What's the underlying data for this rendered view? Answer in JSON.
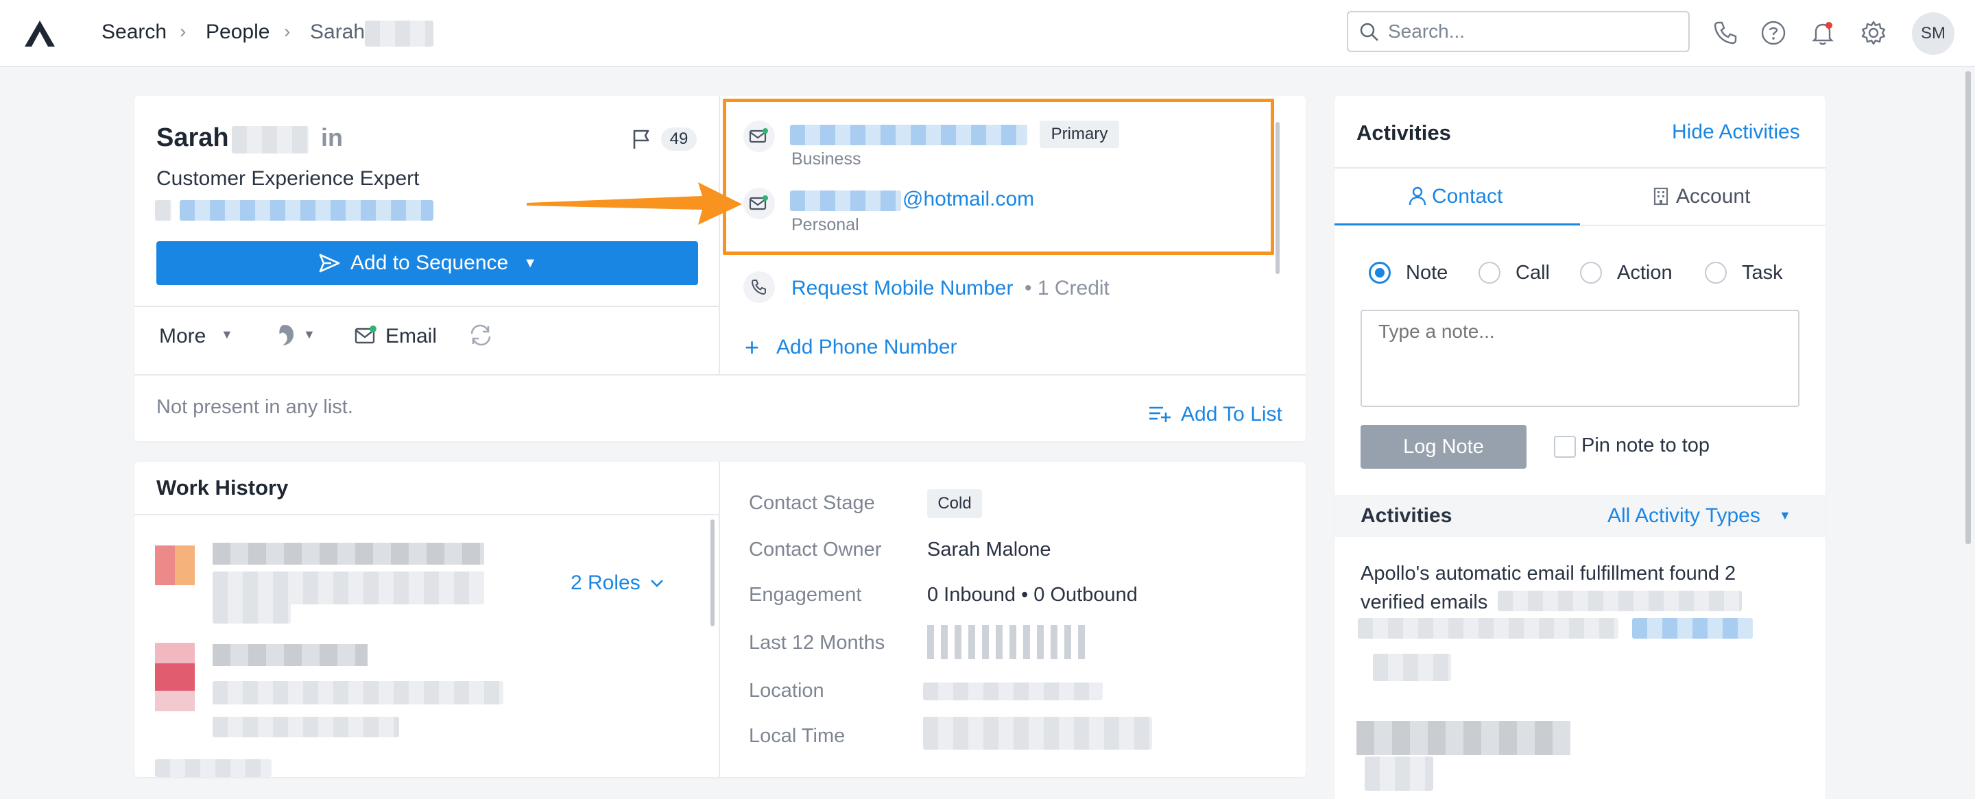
{
  "breadcrumb": {
    "search": "Search",
    "people": "People",
    "person": "Sarah"
  },
  "search": {
    "placeholder": "Search..."
  },
  "user": {
    "initials": "SM"
  },
  "profile": {
    "first_name": "Sarah",
    "linkedin": "in",
    "title": "Customer Experience Expert",
    "flag_count": "49",
    "add_to_sequence": "Add to Sequence",
    "more": "More",
    "email": "Email",
    "lists_status": "Not present in any list.",
    "add_to_list": "Add To List"
  },
  "contact_info": {
    "emails": [
      {
        "domain_suffix": "",
        "badge": "Primary",
        "type": "Business"
      },
      {
        "domain_suffix": "@hotmail.com",
        "type": "Personal"
      }
    ],
    "request_mobile": "Request Mobile Number",
    "credit": "• 1 Credit",
    "add_phone": "Add Phone Number"
  },
  "work_history": {
    "title": "Work History",
    "roles": "2 Roles"
  },
  "details": {
    "rows": [
      {
        "label": "Contact Stage",
        "value": "Cold"
      },
      {
        "label": "Contact Owner",
        "value": "Sarah Malone"
      },
      {
        "label": "Engagement",
        "value": "0 Inbound • 0 Outbound"
      },
      {
        "label": "Last 12 Months",
        "value": ""
      },
      {
        "label": "Location",
        "value": ""
      },
      {
        "label": "Local Time",
        "value": ""
      }
    ]
  },
  "activities": {
    "title": "Activities",
    "hide": "Hide Activities",
    "tabs": [
      "Contact",
      "Account"
    ],
    "types": [
      "Note",
      "Call",
      "Action",
      "Task"
    ],
    "note_placeholder": "Type a note...",
    "log_note": "Log Note",
    "pin_note": "Pin note to top",
    "feed_title": "Activities",
    "filter": "All Activity Types",
    "feed_text": "Apollo's automatic email fulfillment found 2 verified emails"
  },
  "colors": {
    "accent": "#1a86e3",
    "highlight": "#f7931e",
    "verified": "#2bb673"
  }
}
